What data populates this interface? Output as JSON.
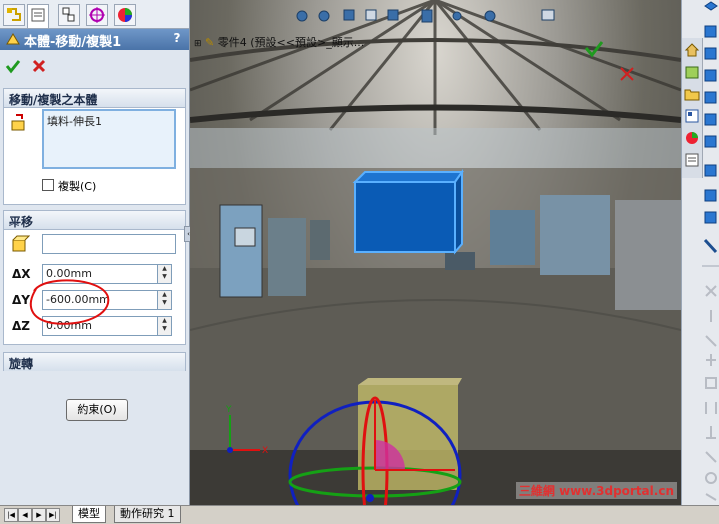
{
  "property_manager": {
    "title": "本體-移動/複製1",
    "help": "?",
    "move_copy_group": {
      "title": "移動/複製之本體",
      "selected_body": "填料-伸長1",
      "copy_label": "複製(C)",
      "copy_checked": false
    },
    "translate_group": {
      "title": "平移",
      "reference": "",
      "dx_label": "ΔX",
      "dx_value": "0.00mm",
      "dy_label": "ΔY",
      "dy_value": "-600.00mm",
      "dz_label": "ΔZ",
      "dz_value": "0.00mm"
    },
    "rotate_group": {
      "title": "旋轉"
    },
    "constraint_button": "約束(O)"
  },
  "viewport": {
    "tree_label": "零件4 (預設<<預設>_顯示..."
  },
  "bottom_tabs": {
    "model": "模型",
    "motion_study": "動作研究 1"
  },
  "watermark": "三維網 www.3dportal.cn",
  "colors": {
    "title_bar": "#4a73a8",
    "ok_green": "#1f9a1f",
    "cancel_red": "#d02020",
    "box_blue": "#0a5bb5",
    "annotation_red": "#e01010"
  }
}
